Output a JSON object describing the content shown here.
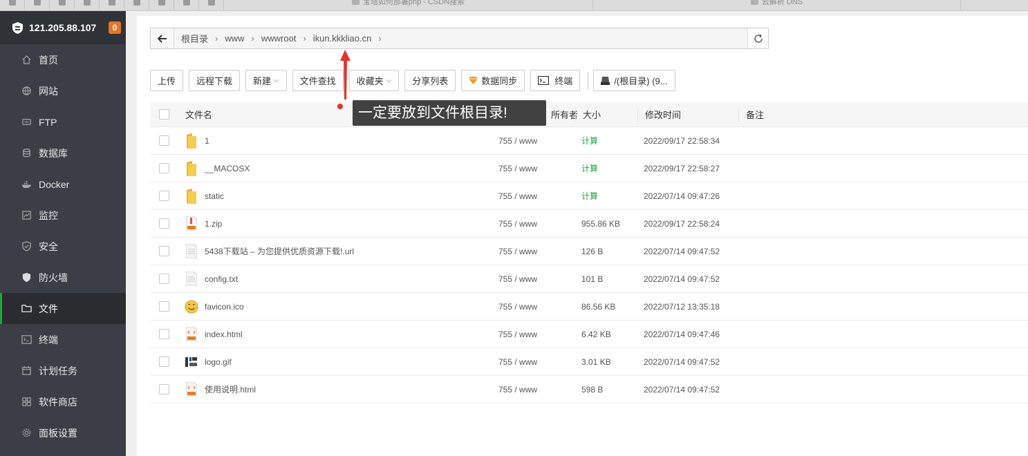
{
  "tabstrip": {
    "tabs": [
      {
        "label": "宝塔如何部署php - CSDN搜索"
      },
      {
        "label": "云解析 DNS"
      }
    ]
  },
  "sidebar": {
    "server_ip": "121.205.88.107",
    "badge": "0",
    "items": [
      {
        "label": "首页",
        "icon": "home-icon"
      },
      {
        "label": "网站",
        "icon": "globe-icon"
      },
      {
        "label": "FTP",
        "icon": "ftp-icon"
      },
      {
        "label": "数据库",
        "icon": "database-icon"
      },
      {
        "label": "Docker",
        "icon": "docker-icon"
      },
      {
        "label": "监控",
        "icon": "monitor-icon"
      },
      {
        "label": "安全",
        "icon": "shield-icon"
      },
      {
        "label": "防火墙",
        "icon": "firewall-icon"
      },
      {
        "label": "文件",
        "icon": "folder-icon",
        "active": true
      },
      {
        "label": "终端",
        "icon": "terminal-icon"
      },
      {
        "label": "计划任务",
        "icon": "calendar-icon"
      },
      {
        "label": "软件商店",
        "icon": "apps-icon"
      },
      {
        "label": "面板设置",
        "icon": "settings-icon"
      }
    ]
  },
  "path": {
    "crumbs": [
      "根目录",
      "www",
      "wwwroot",
      "ikun.kkkliao.cn"
    ]
  },
  "toolbar": {
    "upload": "上传",
    "remote_download": "远程下载",
    "new": "新建",
    "find": "文件查找",
    "favorites": "收藏夹",
    "share_list": "分享列表",
    "sync": "数据同步",
    "terminal": "终端",
    "disk": "/(根目录) (9..."
  },
  "table": {
    "headers": {
      "name": "文件名",
      "owner": "所有者",
      "size": "大小",
      "mtime": "修改时间",
      "note": "备注"
    },
    "rows": [
      {
        "name": "1",
        "icon": "folder-icon",
        "perm": "755 / www",
        "size": "计算",
        "mtime": "2022/09/17 22:58:34"
      },
      {
        "name": "__MACOSX",
        "icon": "folder-icon",
        "perm": "755 / www",
        "size": "计算",
        "mtime": "2022/09/17 22:58:27"
      },
      {
        "name": "static",
        "icon": "folder-icon",
        "perm": "755 / www",
        "size": "计算",
        "mtime": "2022/07/14 09:47:26"
      },
      {
        "name": "1.zip",
        "icon": "zip-file-icon",
        "perm": "755 / www",
        "size": "955.86 KB",
        "mtime": "2022/09/17 22:58:24"
      },
      {
        "name": "5438下载站 – 为您提供优质资源下载!.url",
        "icon": "text-file-icon",
        "perm": "755 / www",
        "size": "126 B",
        "mtime": "2022/07/14 09:47:52"
      },
      {
        "name": "config.txt",
        "icon": "text-file-icon",
        "perm": "755 / www",
        "size": "101 B",
        "mtime": "2022/07/14 09:47:52"
      },
      {
        "name": "favicon.ico",
        "icon": "smiley-image-icon",
        "perm": "755 / www",
        "size": "86.56 KB",
        "mtime": "2022/07/12 13:35:18"
      },
      {
        "name": "index.html",
        "icon": "html-file-icon",
        "perm": "755 / www",
        "size": "6.42 KB",
        "mtime": "2022/07/14 09:47:46"
      },
      {
        "name": "logo.gif",
        "icon": "image-file-icon",
        "perm": "755 / www",
        "size": "3.01 KB",
        "mtime": "2022/07/14 09:47:52"
      },
      {
        "name": "使用说明.html",
        "icon": "html-file-icon",
        "perm": "755 / www",
        "size": "598 B",
        "mtime": "2022/07/14 09:47:52"
      }
    ]
  },
  "annotation": {
    "text": "一定要放到文件根目录!"
  },
  "colors": {
    "accent_green": "#20a53a",
    "sidebar_bg": "#3b3e44",
    "badge_orange": "#e5772a",
    "annotation_red": "#e3342f"
  }
}
